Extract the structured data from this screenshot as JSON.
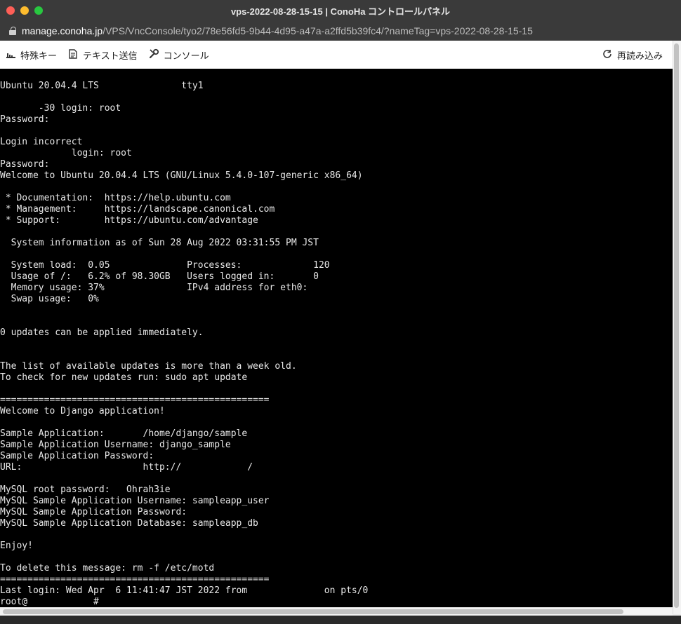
{
  "window": {
    "title": "vps-2022-08-28-15-15 | ConoHa コントロールパネル",
    "url_host": "manage.conoha.jp",
    "url_path": "/VPS/VncConsole/tyo2/78e56fd5-9b44-4d95-a47a-a2ffd5b39fc4/?nameTag=vps-2022-08-28-15-15"
  },
  "toolbar": {
    "special_keys": "特殊キー",
    "send_text": "テキスト送信",
    "console": "コンソール",
    "reload": "再読み込み"
  },
  "terminal": {
    "lines": [
      "Ubuntu 20.04.4 LTS               tty1",
      "",
      "       -30 login: root",
      "Password:",
      "",
      "Login incorrect",
      "             login: root",
      "Password:",
      "Welcome to Ubuntu 20.04.4 LTS (GNU/Linux 5.4.0-107-generic x86_64)",
      "",
      " * Documentation:  https://help.ubuntu.com",
      " * Management:     https://landscape.canonical.com",
      " * Support:        https://ubuntu.com/advantage",
      "",
      "  System information as of Sun 28 Aug 2022 03:31:55 PM JST",
      "",
      "  System load:  0.05              Processes:             120",
      "  Usage of /:   6.2% of 98.30GB   Users logged in:       0",
      "  Memory usage: 37%               IPv4 address for eth0:",
      "  Swap usage:   0%",
      "",
      "",
      "0 updates can be applied immediately.",
      "",
      "",
      "The list of available updates is more than a week old.",
      "To check for new updates run: sudo apt update",
      "",
      "=================================================",
      "Welcome to Django application!",
      "",
      "Sample Application:       /home/django/sample",
      "Sample Application Username: django_sample",
      "Sample Application Password:",
      "URL:                      http://            /",
      "",
      "MySQL root password:   Ohrah3ie",
      "MySQL Sample Application Username: sampleapp_user",
      "MySQL Sample Application Password:",
      "MySQL Sample Application Database: sampleapp_db",
      "",
      "Enjoy!",
      "",
      "To delete this message: rm -f /etc/motd",
      "=================================================",
      "Last login: Wed Apr  6 11:41:47 JST 2022 from              on pts/0",
      "root@            #"
    ]
  }
}
